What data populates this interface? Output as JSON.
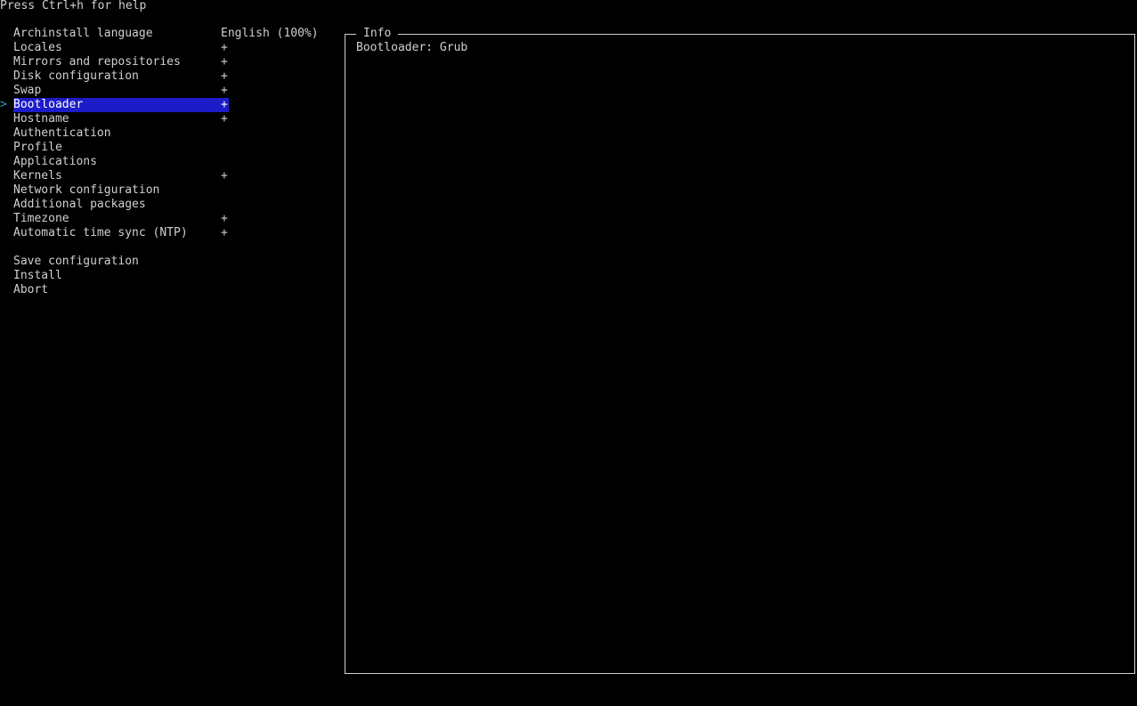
{
  "help_text": "Press Ctrl+h for help",
  "menu": {
    "cursor": ">",
    "items": [
      {
        "label": "Archinstall language",
        "value": "English (100%)"
      },
      {
        "label": "Locales",
        "value": "+"
      },
      {
        "label": "Mirrors and repositories",
        "value": "+"
      },
      {
        "label": "Disk configuration",
        "value": "+"
      },
      {
        "label": "Swap",
        "value": "+"
      },
      {
        "label": "Bootloader",
        "value": "+"
      },
      {
        "label": "Hostname",
        "value": "+"
      },
      {
        "label": "Authentication",
        "value": ""
      },
      {
        "label": "Profile",
        "value": ""
      },
      {
        "label": "Applications",
        "value": ""
      },
      {
        "label": "Kernels",
        "value": "+"
      },
      {
        "label": "Network configuration",
        "value": ""
      },
      {
        "label": "Additional packages",
        "value": ""
      },
      {
        "label": "Timezone",
        "value": "+"
      },
      {
        "label": "Automatic time sync (NTP)",
        "value": "+"
      }
    ],
    "actions": [
      {
        "label": "Save configuration"
      },
      {
        "label": "Install"
      },
      {
        "label": "Abort"
      }
    ]
  },
  "info": {
    "title": "Info",
    "content": "Bootloader: Grub"
  },
  "colors": {
    "background": "#000000",
    "text": "#d0d0d0",
    "selection": "#1c1cc8",
    "cursor": "#2aa1b3"
  }
}
